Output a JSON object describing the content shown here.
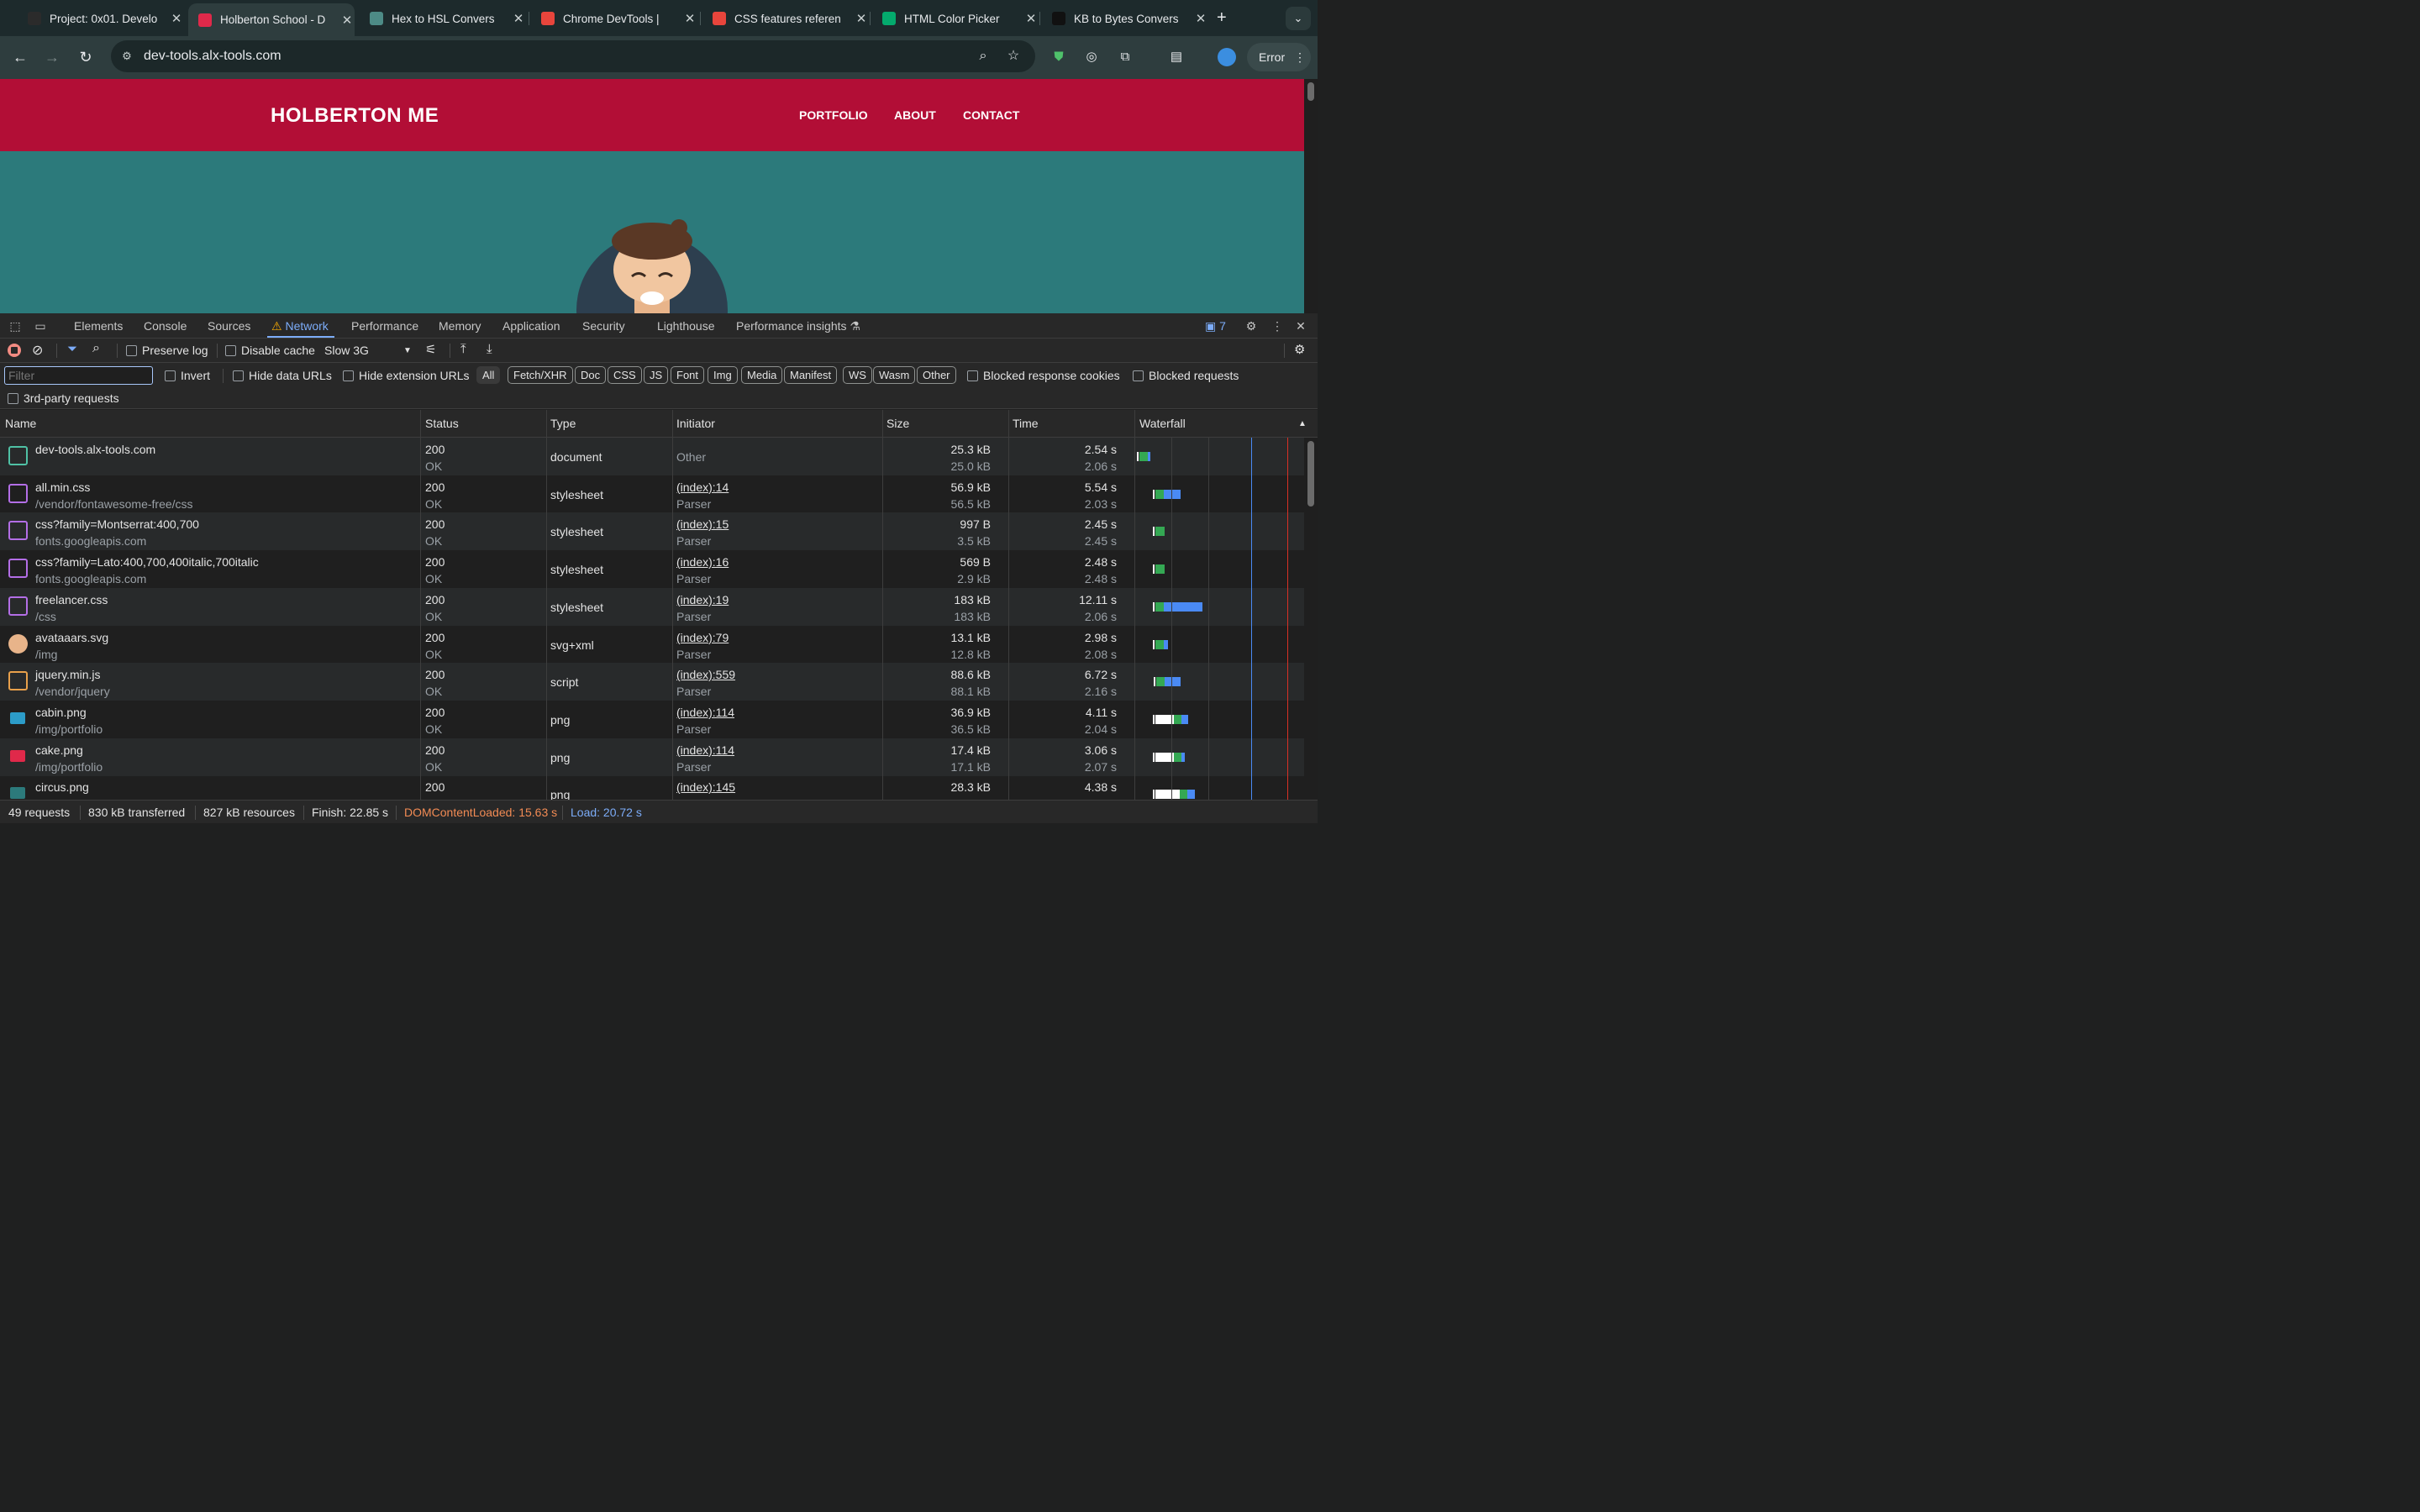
{
  "browser": {
    "tabs": [
      {
        "title": "Project: 0x01. Develo",
        "favicon_color": "#2b2b2b",
        "active": false
      },
      {
        "title": "Holberton School - D",
        "favicon_color": "#e0294a",
        "active": true
      },
      {
        "title": "Hex to HSL Convers",
        "favicon_color": "#4d8b86",
        "active": false
      },
      {
        "title": "Chrome DevTools |",
        "favicon_color": "#e8453c",
        "active": false
      },
      {
        "title": "CSS features referen",
        "favicon_color": "#e8453c",
        "active": false
      },
      {
        "title": "HTML Color Picker",
        "favicon_color": "#04aa6d",
        "active": false
      },
      {
        "title": "KB to Bytes Convers",
        "favicon_color": "#111111",
        "active": false
      }
    ],
    "url": "dev-tools.alx-tools.com",
    "error_label": "Error"
  },
  "page": {
    "brand": "HOLBERTON ME",
    "nav": [
      "PORTFOLIO",
      "ABOUT",
      "CONTACT"
    ]
  },
  "devtools": {
    "tabs": [
      "Elements",
      "Console",
      "Sources",
      "Network",
      "Performance",
      "Memory",
      "Application",
      "Security",
      "Lighthouse",
      "Performance insights"
    ],
    "active_tab": "Network",
    "issues_count": "7",
    "toolbar": {
      "preserve_log": "Preserve log",
      "disable_cache": "Disable cache",
      "throttling": "Slow 3G"
    },
    "filter": {
      "placeholder": "Filter",
      "invert": "Invert",
      "hide_data_urls": "Hide data URLs",
      "hide_extension_urls": "Hide extension URLs",
      "types": [
        "All",
        "Fetch/XHR",
        "Doc",
        "CSS",
        "JS",
        "Font",
        "Img",
        "Media",
        "Manifest",
        "WS",
        "Wasm",
        "Other"
      ],
      "blocked_response_cookies": "Blocked response cookies",
      "blocked_requests": "Blocked requests",
      "third_party": "3rd-party requests"
    },
    "columns": [
      "Name",
      "Status",
      "Type",
      "Initiator",
      "Size",
      "Time",
      "Waterfall"
    ],
    "rows": [
      {
        "name": "dev-tools.alx-tools.com",
        "path": "",
        "icon": "document-icon",
        "status": "200",
        "status_text": "OK",
        "type": "document",
        "initiator": "Other",
        "initiator_sub": "",
        "size": "25.3 kB",
        "resource": "25.0 kB",
        "time": "2.54 s",
        "latency": "2.06 s",
        "wf": {
          "start": 0.0,
          "ttfb": 0.5,
          "dl": 0.15
        }
      },
      {
        "name": "all.min.css",
        "path": "/vendor/fontawesome-free/css",
        "icon": "stylesheet-icon",
        "status": "200",
        "status_text": "OK",
        "type": "stylesheet",
        "initiator": "(index):14",
        "initiator_sub": "Parser",
        "size": "56.9 kB",
        "resource": "56.5 kB",
        "time": "5.54 s",
        "latency": "2.03 s",
        "wf": {
          "start": 2.6,
          "ttfb": 0.5,
          "dl": 1.0
        }
      },
      {
        "name": "css?family=Montserrat:400,700",
        "path": "fonts.googleapis.com",
        "icon": "stylesheet-icon",
        "status": "200",
        "status_text": "OK",
        "type": "stylesheet",
        "initiator": "(index):15",
        "initiator_sub": "Parser",
        "size": "997 B",
        "resource": "3.5 kB",
        "time": "2.45 s",
        "latency": "2.45 s",
        "wf": {
          "start": 2.6,
          "ttfb": 0.55,
          "dl": 0.0
        }
      },
      {
        "name": "css?family=Lato:400,700,400italic,700italic",
        "path": "fonts.googleapis.com",
        "icon": "stylesheet-icon",
        "status": "200",
        "status_text": "OK",
        "type": "stylesheet",
        "initiator": "(index):16",
        "initiator_sub": "Parser",
        "size": "569 B",
        "resource": "2.9 kB",
        "time": "2.48 s",
        "latency": "2.48 s",
        "wf": {
          "start": 2.6,
          "ttfb": 0.55,
          "dl": 0.0
        }
      },
      {
        "name": "freelancer.css",
        "path": "/css",
        "icon": "stylesheet-icon",
        "status": "200",
        "status_text": "OK",
        "type": "stylesheet",
        "initiator": "(index):19",
        "initiator_sub": "Parser",
        "size": "183 kB",
        "resource": "183 kB",
        "time": "12.11 s",
        "latency": "2.06 s",
        "wf": {
          "start": 2.6,
          "ttfb": 0.5,
          "dl": 2.3
        }
      },
      {
        "name": "avataaars.svg",
        "path": "/img",
        "icon": "svg-image-icon",
        "status": "200",
        "status_text": "OK",
        "type": "svg+xml",
        "initiator": "(index):79",
        "initiator_sub": "Parser",
        "size": "13.1 kB",
        "resource": "12.8 kB",
        "time": "2.98 s",
        "latency": "2.08 s",
        "wf": {
          "start": 2.6,
          "ttfb": 0.5,
          "dl": 0.25
        }
      },
      {
        "name": "jquery.min.js",
        "path": "/vendor/jquery",
        "icon": "script-icon",
        "status": "200",
        "status_text": "OK",
        "type": "script",
        "initiator": "(index):559",
        "initiator_sub": "Parser",
        "size": "88.6 kB",
        "resource": "88.1 kB",
        "time": "6.72 s",
        "latency": "2.16 s",
        "wf": {
          "start": 2.8,
          "ttfb": 0.5,
          "dl": 0.95
        }
      },
      {
        "name": "cabin.png",
        "path": "/img/portfolio",
        "icon": "png-image-icon",
        "status": "200",
        "status_text": "OK",
        "type": "png",
        "initiator": "(index):114",
        "initiator_sub": "Parser",
        "size": "36.9 kB",
        "resource": "36.5 kB",
        "time": "4.11 s",
        "latency": "2.04 s",
        "wf": {
          "start": 2.6,
          "wait": 1.1,
          "ttfb": 0.45,
          "dl": 0.4
        }
      },
      {
        "name": "cake.png",
        "path": "/img/portfolio",
        "icon": "png-image-icon",
        "status": "200",
        "status_text": "OK",
        "type": "png",
        "initiator": "(index):114",
        "initiator_sub": "Parser",
        "size": "17.4 kB",
        "resource": "17.1 kB",
        "time": "3.06 s",
        "latency": "2.07 s",
        "wf": {
          "start": 2.6,
          "wait": 1.1,
          "ttfb": 0.45,
          "dl": 0.2
        }
      },
      {
        "name": "circus.png",
        "path": "",
        "icon": "png-image-icon",
        "status": "200",
        "status_text": "",
        "type": "png",
        "initiator": "(index):145",
        "initiator_sub": "",
        "size": "28.3 kB",
        "resource": "",
        "time": "4.38 s",
        "latency": "",
        "wf": {
          "start": 2.6,
          "wait": 1.45,
          "ttfb": 0.45,
          "dl": 0.45
        }
      }
    ],
    "summary": {
      "requests": "49 requests",
      "transferred": "830 kB transferred",
      "resources": "827 kB resources",
      "finish": "Finish: 22.85 s",
      "dcl": "DOMContentLoaded: 15.63 s",
      "load": "Load: 20.72 s"
    },
    "colors": {
      "accent": "#7cacf8",
      "dcl": "#f28b54",
      "load": "#7cacf8",
      "page_header": "#b20e36",
      "page_bg": "#2c7a7b"
    }
  }
}
